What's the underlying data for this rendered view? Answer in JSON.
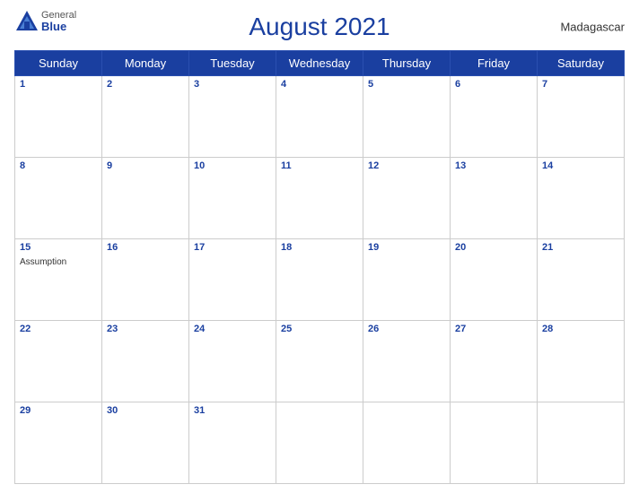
{
  "header": {
    "title": "August 2021",
    "country": "Madagascar",
    "logo": {
      "general": "General",
      "blue": "Blue"
    }
  },
  "weekdays": [
    "Sunday",
    "Monday",
    "Tuesday",
    "Wednesday",
    "Thursday",
    "Friday",
    "Saturday"
  ],
  "weeks": [
    [
      {
        "day": "1",
        "events": []
      },
      {
        "day": "2",
        "events": []
      },
      {
        "day": "3",
        "events": []
      },
      {
        "day": "4",
        "events": []
      },
      {
        "day": "5",
        "events": []
      },
      {
        "day": "6",
        "events": []
      },
      {
        "day": "7",
        "events": []
      }
    ],
    [
      {
        "day": "8",
        "events": []
      },
      {
        "day": "9",
        "events": []
      },
      {
        "day": "10",
        "events": []
      },
      {
        "day": "11",
        "events": []
      },
      {
        "day": "12",
        "events": []
      },
      {
        "day": "13",
        "events": []
      },
      {
        "day": "14",
        "events": []
      }
    ],
    [
      {
        "day": "15",
        "events": [
          "Assumption"
        ]
      },
      {
        "day": "16",
        "events": []
      },
      {
        "day": "17",
        "events": []
      },
      {
        "day": "18",
        "events": []
      },
      {
        "day": "19",
        "events": []
      },
      {
        "day": "20",
        "events": []
      },
      {
        "day": "21",
        "events": []
      }
    ],
    [
      {
        "day": "22",
        "events": []
      },
      {
        "day": "23",
        "events": []
      },
      {
        "day": "24",
        "events": []
      },
      {
        "day": "25",
        "events": []
      },
      {
        "day": "26",
        "events": []
      },
      {
        "day": "27",
        "events": []
      },
      {
        "day": "28",
        "events": []
      }
    ],
    [
      {
        "day": "29",
        "events": []
      },
      {
        "day": "30",
        "events": []
      },
      {
        "day": "31",
        "events": []
      },
      {
        "day": "",
        "events": []
      },
      {
        "day": "",
        "events": []
      },
      {
        "day": "",
        "events": []
      },
      {
        "day": "",
        "events": []
      }
    ]
  ]
}
